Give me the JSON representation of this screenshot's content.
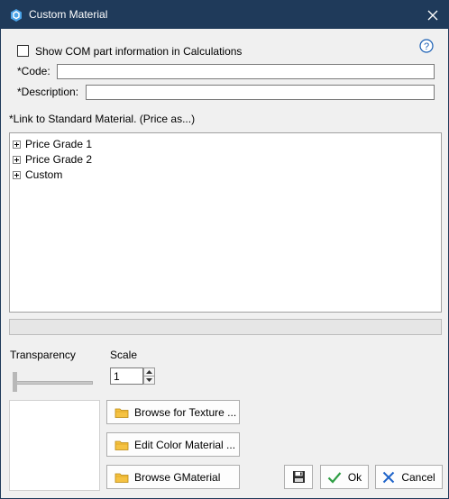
{
  "window": {
    "title": "Custom Material"
  },
  "show_com": {
    "label": "Show COM part information in Calculations",
    "checked": false
  },
  "code": {
    "label": "*Code:",
    "value": ""
  },
  "description": {
    "label": "*Description:",
    "value": ""
  },
  "link_section": {
    "label": "*Link to Standard Material. (Price as...)",
    "items": [
      {
        "label": "Price Grade 1"
      },
      {
        "label": "Price Grade 2"
      },
      {
        "label": "Custom"
      }
    ]
  },
  "transparency": {
    "label": "Transparency",
    "level": 0
  },
  "scale": {
    "label": "Scale",
    "value": "1"
  },
  "buttons": {
    "browse_texture": "Browse for Texture ...",
    "edit_color": "Edit Color Material ...",
    "browse_gmaterial": "Browse GMaterial",
    "ok": "Ok",
    "cancel": "Cancel"
  },
  "icons": {
    "app": "hexagon-logo-icon",
    "close": "close-icon",
    "help": "help-icon",
    "folder": "folder-icon",
    "save": "save-icon",
    "ok": "checkmark-icon",
    "cancel": "x-icon"
  },
  "colors": {
    "titlebar": "#1f3a5a",
    "window_bg": "#f0f0f0",
    "help_blue": "#1a5fb4",
    "ok_green": "#2e9e44",
    "cancel_blue": "#1e63c9",
    "folder_yellow": "#f5c242"
  }
}
